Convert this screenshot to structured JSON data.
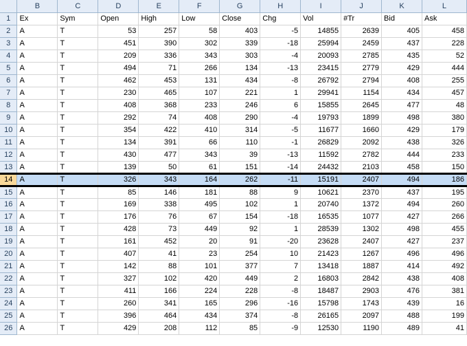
{
  "columns": [
    "B",
    "C",
    "D",
    "E",
    "F",
    "G",
    "H",
    "I",
    "J",
    "K",
    "L"
  ],
  "headers": [
    "Ex",
    "Sym",
    "Open",
    "High",
    "Low",
    "Close",
    "Chg",
    "Vol",
    "#Tr",
    "Bid",
    "Ask"
  ],
  "selected_row": 14,
  "colors": {
    "header_bg": "#e4ecf7",
    "selection": "#c5dcf5",
    "selected_rowhdr": "#f9d99a"
  },
  "rows": [
    {
      "n": "2",
      "ex": "A",
      "sym": "T",
      "v": [
        "53",
        "257",
        "58",
        "403",
        "-5",
        "14855",
        "2639",
        "405",
        "458"
      ]
    },
    {
      "n": "3",
      "ex": "A",
      "sym": "T",
      "v": [
        "451",
        "390",
        "302",
        "339",
        "-18",
        "25994",
        "2459",
        "437",
        "228"
      ]
    },
    {
      "n": "4",
      "ex": "A",
      "sym": "T",
      "v": [
        "209",
        "336",
        "343",
        "303",
        "-4",
        "20093",
        "2785",
        "435",
        "52"
      ]
    },
    {
      "n": "5",
      "ex": "A",
      "sym": "T",
      "v": [
        "494",
        "71",
        "266",
        "134",
        "-13",
        "23415",
        "2779",
        "429",
        "444"
      ]
    },
    {
      "n": "6",
      "ex": "A",
      "sym": "T",
      "v": [
        "462",
        "453",
        "131",
        "434",
        "-8",
        "26792",
        "2794",
        "408",
        "255"
      ]
    },
    {
      "n": "7",
      "ex": "A",
      "sym": "T",
      "v": [
        "230",
        "465",
        "107",
        "221",
        "1",
        "29941",
        "1154",
        "434",
        "457"
      ]
    },
    {
      "n": "8",
      "ex": "A",
      "sym": "T",
      "v": [
        "408",
        "368",
        "233",
        "246",
        "6",
        "15855",
        "2645",
        "477",
        "48"
      ]
    },
    {
      "n": "9",
      "ex": "A",
      "sym": "T",
      "v": [
        "292",
        "74",
        "408",
        "290",
        "-4",
        "19793",
        "1899",
        "498",
        "380"
      ]
    },
    {
      "n": "10",
      "ex": "A",
      "sym": "T",
      "v": [
        "354",
        "422",
        "410",
        "314",
        "-5",
        "11677",
        "1660",
        "429",
        "179"
      ]
    },
    {
      "n": "11",
      "ex": "A",
      "sym": "T",
      "v": [
        "134",
        "391",
        "66",
        "110",
        "-1",
        "26829",
        "2092",
        "438",
        "326"
      ]
    },
    {
      "n": "12",
      "ex": "A",
      "sym": "T",
      "v": [
        "430",
        "477",
        "343",
        "39",
        "-13",
        "11592",
        "2782",
        "444",
        "233"
      ]
    },
    {
      "n": "13",
      "ex": "A",
      "sym": "T",
      "v": [
        "139",
        "50",
        "61",
        "151",
        "-14",
        "24432",
        "2103",
        "458",
        "150"
      ]
    },
    {
      "n": "14",
      "ex": "A",
      "sym": "T",
      "v": [
        "326",
        "343",
        "164",
        "262",
        "-11",
        "15191",
        "2407",
        "494",
        "186"
      ]
    },
    {
      "n": "15",
      "ex": "A",
      "sym": "T",
      "v": [
        "85",
        "146",
        "181",
        "88",
        "9",
        "10621",
        "2370",
        "437",
        "195"
      ]
    },
    {
      "n": "16",
      "ex": "A",
      "sym": "T",
      "v": [
        "169",
        "338",
        "495",
        "102",
        "1",
        "20740",
        "1372",
        "494",
        "260"
      ]
    },
    {
      "n": "17",
      "ex": "A",
      "sym": "T",
      "v": [
        "176",
        "76",
        "67",
        "154",
        "-18",
        "16535",
        "1077",
        "427",
        "266"
      ]
    },
    {
      "n": "18",
      "ex": "A",
      "sym": "T",
      "v": [
        "428",
        "73",
        "449",
        "92",
        "1",
        "28539",
        "1302",
        "498",
        "455"
      ]
    },
    {
      "n": "19",
      "ex": "A",
      "sym": "T",
      "v": [
        "161",
        "452",
        "20",
        "91",
        "-20",
        "23628",
        "2407",
        "427",
        "237"
      ]
    },
    {
      "n": "20",
      "ex": "A",
      "sym": "T",
      "v": [
        "407",
        "41",
        "23",
        "254",
        "10",
        "21423",
        "1267",
        "496",
        "496"
      ]
    },
    {
      "n": "21",
      "ex": "A",
      "sym": "T",
      "v": [
        "142",
        "88",
        "101",
        "377",
        "7",
        "13418",
        "1887",
        "414",
        "492"
      ]
    },
    {
      "n": "22",
      "ex": "A",
      "sym": "T",
      "v": [
        "327",
        "102",
        "420",
        "449",
        "2",
        "16803",
        "2842",
        "438",
        "408"
      ]
    },
    {
      "n": "23",
      "ex": "A",
      "sym": "T",
      "v": [
        "411",
        "166",
        "224",
        "228",
        "-8",
        "18487",
        "2903",
        "476",
        "381"
      ]
    },
    {
      "n": "24",
      "ex": "A",
      "sym": "T",
      "v": [
        "260",
        "341",
        "165",
        "296",
        "-16",
        "15798",
        "1743",
        "439",
        "16"
      ]
    },
    {
      "n": "25",
      "ex": "A",
      "sym": "T",
      "v": [
        "396",
        "464",
        "434",
        "374",
        "-8",
        "26165",
        "2097",
        "488",
        "199"
      ]
    },
    {
      "n": "26",
      "ex": "A",
      "sym": "T",
      "v": [
        "429",
        "208",
        "112",
        "85",
        "-9",
        "12530",
        "1190",
        "489",
        "41"
      ]
    }
  ]
}
